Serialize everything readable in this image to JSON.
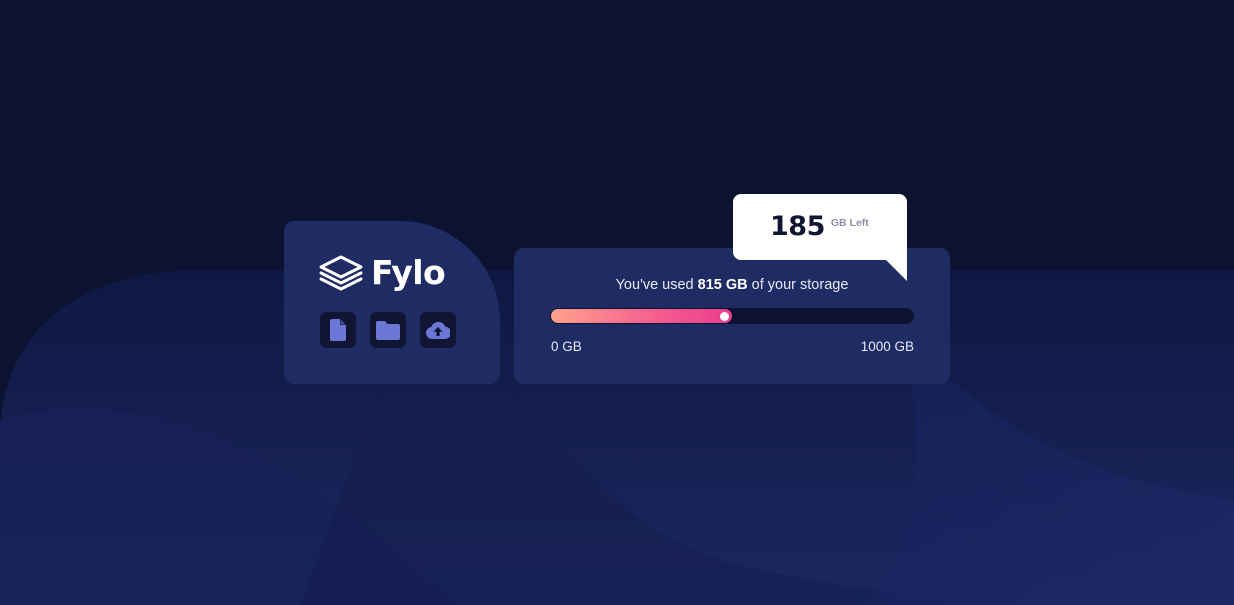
{
  "brand": {
    "name": "Fylo"
  },
  "toolbar": {
    "icons": [
      "document-icon",
      "folder-icon",
      "upload-cloud-icon"
    ]
  },
  "storage": {
    "usage_prefix": "You've used ",
    "used_amount": "815 GB",
    "usage_suffix": " of your storage",
    "used_value": 815,
    "total_value": 1000,
    "min_label": "0 GB",
    "max_label": "1000 GB"
  },
  "remaining": {
    "number": "185",
    "unit": "GB Left"
  },
  "colors": {
    "page_background": "#0c1330",
    "card_background": "#1f2b63",
    "icon_button_background": "#0f1533",
    "icon_color": "#6b77d4",
    "gradient_start": "#ffa18e",
    "gradient_end": "#ea3d8e"
  }
}
